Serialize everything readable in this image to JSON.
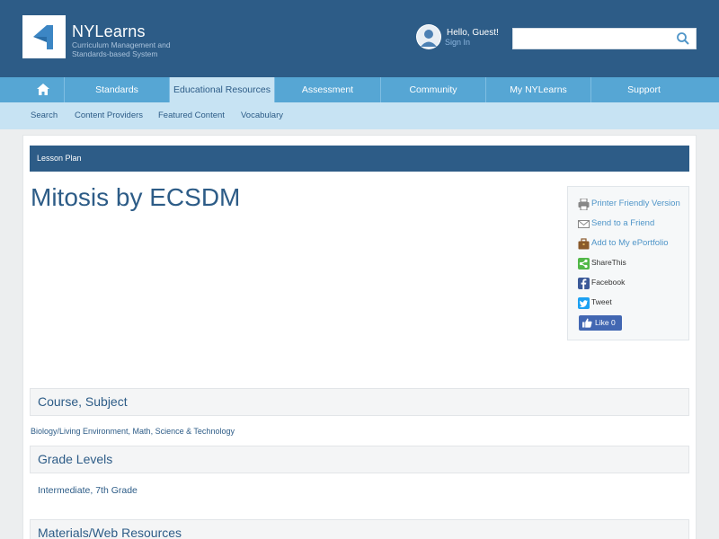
{
  "header": {
    "brand_name": "NYLearns",
    "brand_tagline": "Curriculum Management and Standards-based System",
    "greeting": "Hello, Guest!",
    "signin_label": "Sign In",
    "search_value": "",
    "search_placeholder": ""
  },
  "main_nav": {
    "home_icon": "home-icon",
    "items": [
      {
        "label": "Standards"
      },
      {
        "label": "Educational Resources",
        "active": true
      },
      {
        "label": "Assessment"
      },
      {
        "label": "Community"
      },
      {
        "label": "My NYLearns"
      },
      {
        "label": "Support"
      }
    ]
  },
  "sub_nav": {
    "items": [
      {
        "label": "Search"
      },
      {
        "label": "Content Providers"
      },
      {
        "label": "Featured Content"
      },
      {
        "label": "Vocabulary"
      }
    ]
  },
  "page": {
    "type_label": "Lesson Plan",
    "title": "Mitosis by ECSDM"
  },
  "share": {
    "printer": "Printer Friendly Version",
    "send": "Send to a Friend",
    "portfolio": "Add to My ePortfolio",
    "sharethis": "ShareThis",
    "facebook": "Facebook",
    "tweet": "Tweet",
    "like": "Like 0"
  },
  "sections": {
    "course_title": "Course, Subject",
    "course_value": "Biology/Living Environment, Math, Science & Technology",
    "grade_title": "Grade Levels",
    "grade_value": "Intermediate, 7th Grade",
    "materials_title": "Materials/Web Resources"
  },
  "colors": {
    "header_bg": "#2d5c87",
    "nav_bg": "#56a6d4",
    "subnav_bg": "#c7e3f3",
    "link": "#4f95c8",
    "facebook": "#3b5998",
    "twitter": "#1da1f2",
    "sharethis": "#52b848"
  }
}
